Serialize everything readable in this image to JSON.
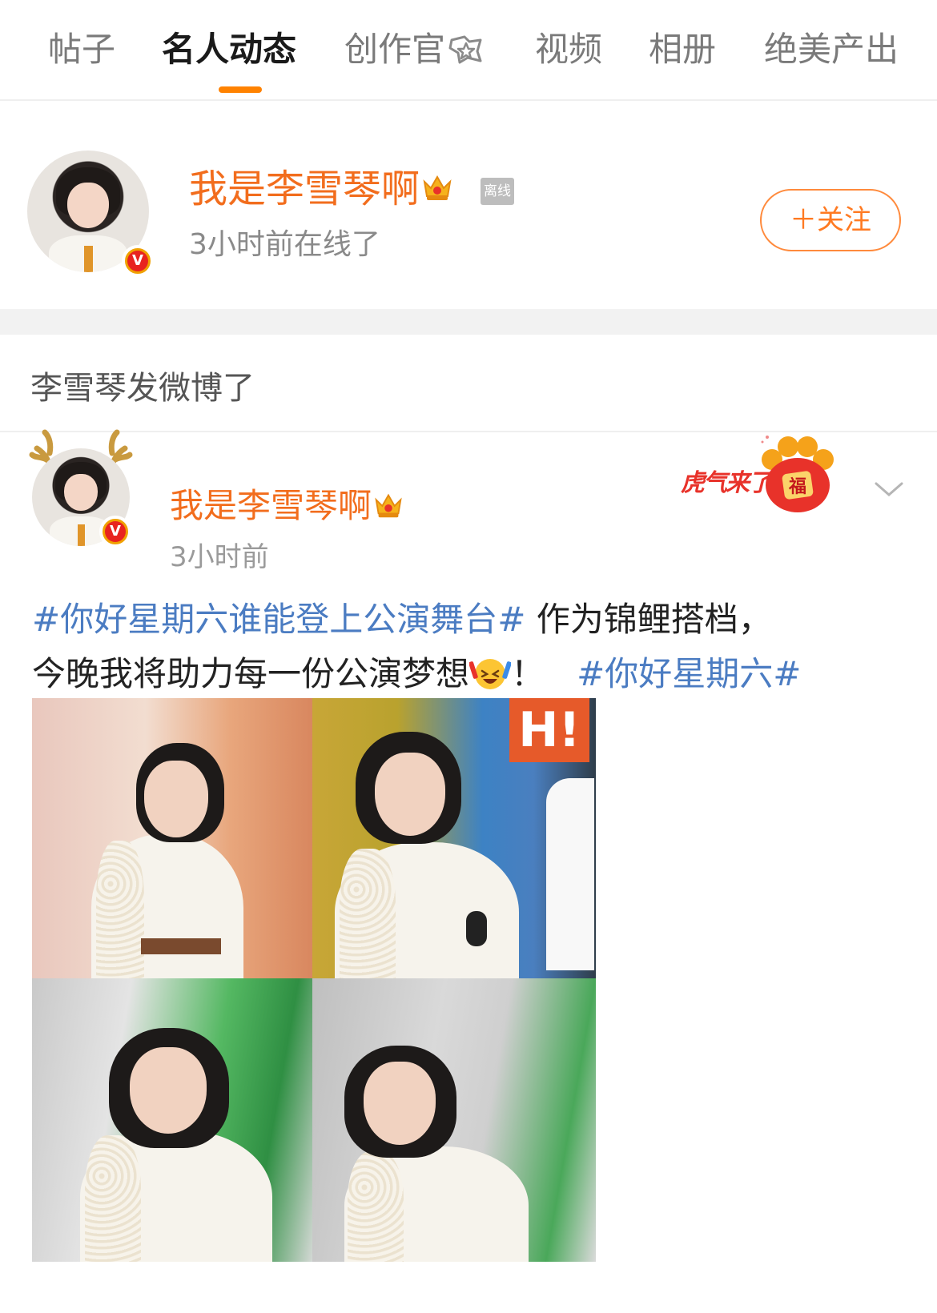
{
  "tabs": [
    {
      "label": "帖子",
      "active": false
    },
    {
      "label": "名人动态",
      "active": true
    },
    {
      "label": "创作官",
      "active": false,
      "icon": "badge-star-icon"
    },
    {
      "label": "视频",
      "active": false
    },
    {
      "label": "相册",
      "active": false
    },
    {
      "label": "绝美产出",
      "active": false
    }
  ],
  "profile": {
    "name": "我是李雪琴啊",
    "status_tag": "离线",
    "last_online": "3小时前在线了",
    "follow_label": "＋关注",
    "verified_icon": "verified-v-icon",
    "crown_icon": "crown-icon"
  },
  "section": {
    "title": "李雪琴发微博了"
  },
  "post": {
    "author": "我是李雪琴啊",
    "time": "3小时前",
    "decoration_text": "虎气来了",
    "decoration_icon": "tiger-paw-fu-icon",
    "body": {
      "hashtag1": "#你好星期六谁能登上公演舞台#",
      "text1": " 作为锦鲤搭档，",
      "text2": "今晚我将助力每一份公演梦想",
      "emoji": "cheering-face-emoji",
      "text3": "！",
      "hashtag2": "#你好星期六#"
    },
    "images": [
      "photo-1",
      "photo-2",
      "photo-3",
      "photo-4"
    ]
  },
  "colors": {
    "accent": "#ff8200",
    "name_orange": "#f26d1d",
    "hashtag_blue": "#4b7cc2",
    "gap_gray": "#f2f2f2"
  }
}
